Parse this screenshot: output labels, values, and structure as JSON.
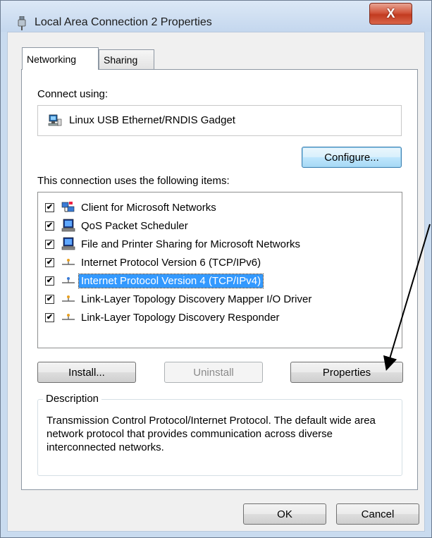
{
  "window": {
    "title": "Local Area Connection 2 Properties",
    "close_label": "X"
  },
  "tabs": [
    {
      "label": "Networking",
      "active": true
    },
    {
      "label": "Sharing",
      "active": false
    }
  ],
  "connect_using": {
    "label": "Connect using:",
    "adapter_name": "Linux USB Ethernet/RNDIS Gadget",
    "adapter_icon": "network-adapter-icon",
    "configure_button": "Configure..."
  },
  "items_section": {
    "label": "This connection uses the following items:",
    "items": [
      {
        "label": "Client for Microsoft Networks",
        "checked": true,
        "icon": "network-client-icon",
        "selected": false
      },
      {
        "label": "QoS Packet Scheduler",
        "checked": true,
        "icon": "service-icon",
        "selected": false
      },
      {
        "label": "File and Printer Sharing for Microsoft Networks",
        "checked": true,
        "icon": "service-icon",
        "selected": false
      },
      {
        "label": "Internet Protocol Version 6 (TCP/IPv6)",
        "checked": true,
        "icon": "protocol-icon",
        "selected": false
      },
      {
        "label": "Internet Protocol Version 4 (TCP/IPv4)",
        "checked": true,
        "icon": "protocol-icon",
        "selected": true
      },
      {
        "label": "Link-Layer Topology Discovery Mapper I/O Driver",
        "checked": true,
        "icon": "protocol-icon",
        "selected": false
      },
      {
        "label": "Link-Layer Topology Discovery Responder",
        "checked": true,
        "icon": "protocol-icon",
        "selected": false
      }
    ]
  },
  "buttons": {
    "install": "Install...",
    "uninstall": "Uninstall",
    "properties": "Properties",
    "ok": "OK",
    "cancel": "Cancel"
  },
  "description": {
    "title": "Description",
    "text": "Transmission Control Protocol/Internet Protocol. The default wide area network protocol that provides communication across diverse interconnected networks."
  },
  "colors": {
    "selection": "#3399ff",
    "close_button": "#c94a2e",
    "window_frame": "#c9dbef"
  }
}
